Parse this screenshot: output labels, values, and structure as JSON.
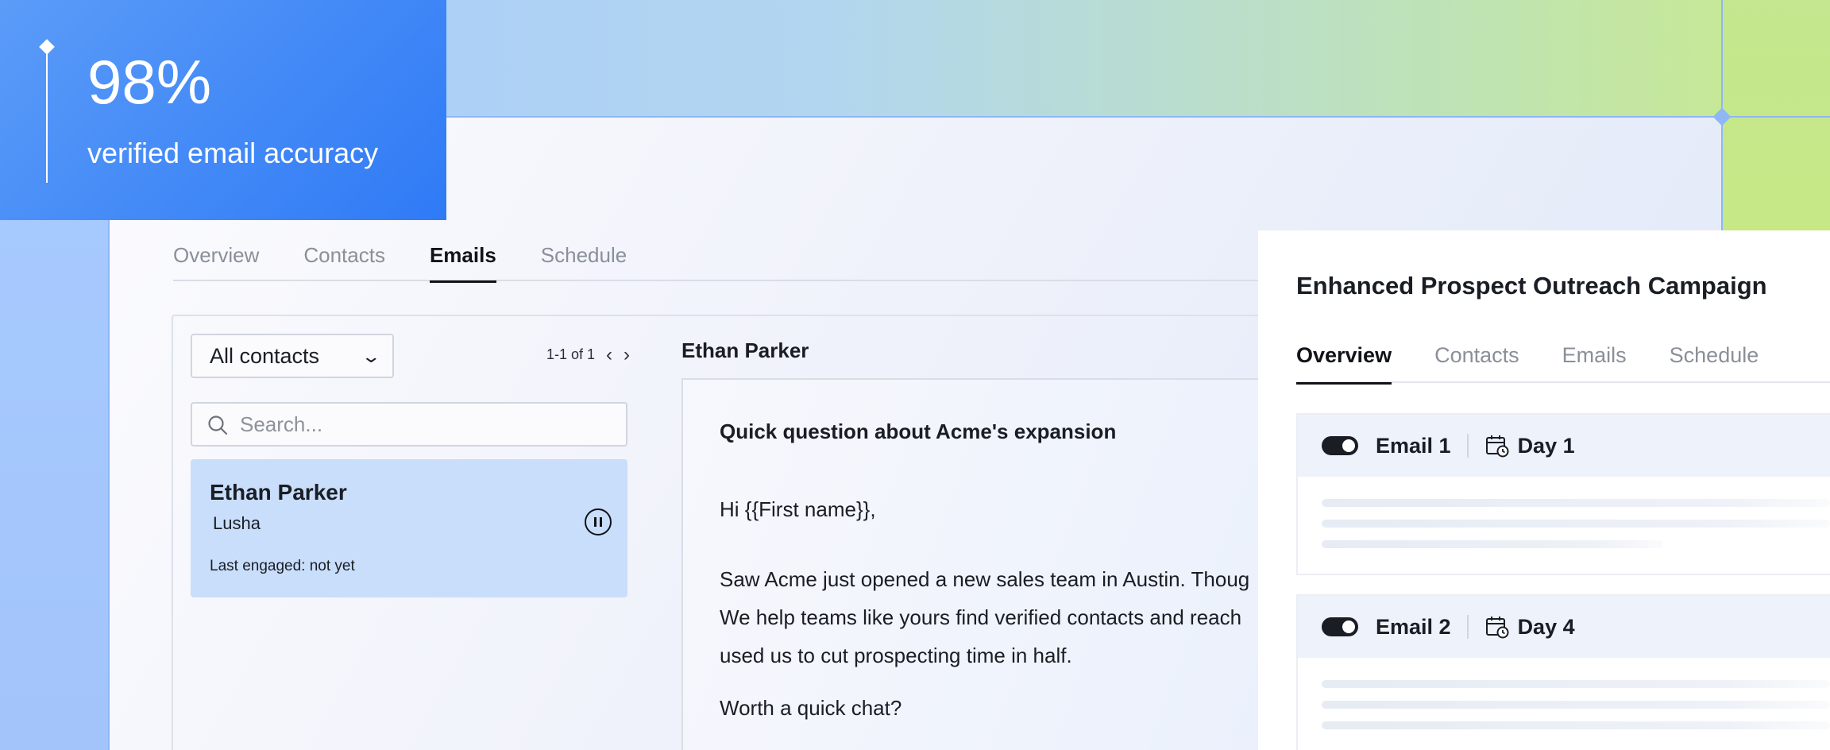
{
  "stat": {
    "value": "98%",
    "label": "verified email accuracy"
  },
  "tabs": [
    "Overview",
    "Contacts",
    "Emails",
    "Schedule"
  ],
  "active_tab": "Emails",
  "contacts": {
    "filter_value": "All contacts",
    "pager": "1-1 of 1",
    "search_placeholder": "Search...",
    "items": [
      {
        "name": "Ethan Parker",
        "company": "Lusha",
        "engaged": "Last engaged: not yet"
      }
    ]
  },
  "email": {
    "recipient": "Ethan Parker",
    "subject": "Quick question about Acme's expansion",
    "lines": [
      "Hi {{First name}},",
      "Saw Acme just opened a new sales team in Austin. Thoug",
      "We help teams like yours find verified contacts and reach",
      "used us to cut prospecting time in half.",
      "Worth a quick chat?"
    ]
  },
  "campaign": {
    "title": "Enhanced Prospect Outreach Campaign",
    "tabs": [
      "Overview",
      "Contacts",
      "Emails",
      "Schedule"
    ],
    "active_tab": "Overview",
    "steps": [
      {
        "label": "Email 1",
        "day": "Day 1",
        "enabled": true
      },
      {
        "label": "Email 2",
        "day": "Day 4",
        "enabled": true
      }
    ]
  },
  "colors": {
    "accent_blue": "#2f7af6",
    "selected_row": "#c9defb",
    "guide": "#8db7f5"
  }
}
